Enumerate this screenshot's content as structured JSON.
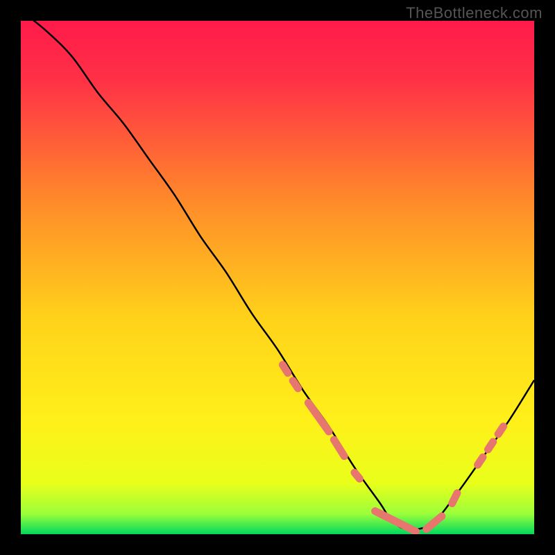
{
  "watermark": "TheBottleneck.com",
  "chart_data": {
    "type": "line",
    "title": "",
    "xlabel": "",
    "ylabel": "",
    "xlim": [
      0,
      100
    ],
    "ylim": [
      0,
      100
    ],
    "background_gradient": {
      "top": "#ff1a4a",
      "middle": "#ffe100",
      "bottom": "#00d95f"
    },
    "series": [
      {
        "name": "bottleneck-curve",
        "x": [
          0,
          5,
          10,
          15,
          20,
          25,
          30,
          35,
          40,
          45,
          50,
          55,
          60,
          65,
          70,
          72,
          75,
          80,
          85,
          90,
          95,
          100
        ],
        "values": [
          102,
          98,
          93,
          86,
          80,
          73,
          66,
          58,
          51,
          43,
          36,
          28,
          21,
          13,
          6,
          3,
          1,
          2,
          8,
          15,
          22,
          30
        ],
        "stroke": "#000000"
      }
    ],
    "highlight_segments": [
      {
        "x0": 51,
        "y0": 33.0,
        "x1": 52,
        "y1": 31.4
      },
      {
        "x0": 53,
        "y0": 29.9,
        "x1": 54,
        "y1": 28.4
      },
      {
        "x0": 56,
        "y0": 25.6,
        "x1": 60,
        "y1": 20.0
      },
      {
        "x0": 61,
        "y0": 18.4,
        "x1": 63,
        "y1": 15.2
      },
      {
        "x0": 65,
        "y0": 12.0,
        "x1": 66,
        "y1": 10.8
      },
      {
        "x0": 69,
        "y0": 4.5,
        "x1": 77,
        "y1": 0.5
      },
      {
        "x0": 79,
        "y0": 1.0,
        "x1": 82,
        "y1": 3.5
      },
      {
        "x0": 84,
        "y0": 6.0,
        "x1": 85,
        "y1": 8.0
      },
      {
        "x0": 89,
        "y0": 13.5,
        "x1": 90,
        "y1": 15.0
      },
      {
        "x0": 91,
        "y0": 16.5,
        "x1": 92,
        "y1": 18.0
      },
      {
        "x0": 93,
        "y0": 19.5,
        "x1": 94,
        "y1": 21.0
      }
    ],
    "colors": {
      "curve": "#000000",
      "highlight": "#e7766f"
    }
  }
}
